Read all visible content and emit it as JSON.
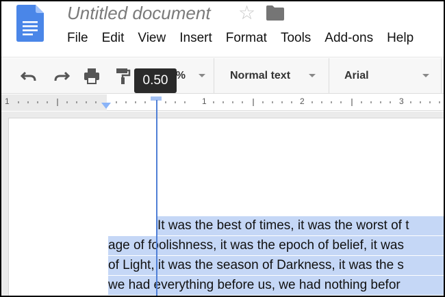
{
  "window": {
    "title": "Untitled document"
  },
  "menu": [
    "File",
    "Edit",
    "View",
    "Insert",
    "Format",
    "Tools",
    "Add-ons",
    "Help"
  ],
  "toolbar": {
    "zoom": "100%",
    "style": "Normal text",
    "font": "Arial"
  },
  "tooltip": {
    "value": "0.50"
  },
  "ruler": {
    "labels": [
      "1",
      "1",
      "2",
      "3"
    ]
  },
  "document": {
    "lines": [
      "It was the best of times, it was the worst of t",
      "age of foolishness, it was the epoch of belief, it was",
      "of Light, it was the season of Darkness, it was the s",
      "we had everything before us, we had nothing befor"
    ]
  },
  "colors": {
    "accent": "#4f7fd6",
    "selection": "#c5d7f6",
    "logo": "#4a86e8"
  }
}
